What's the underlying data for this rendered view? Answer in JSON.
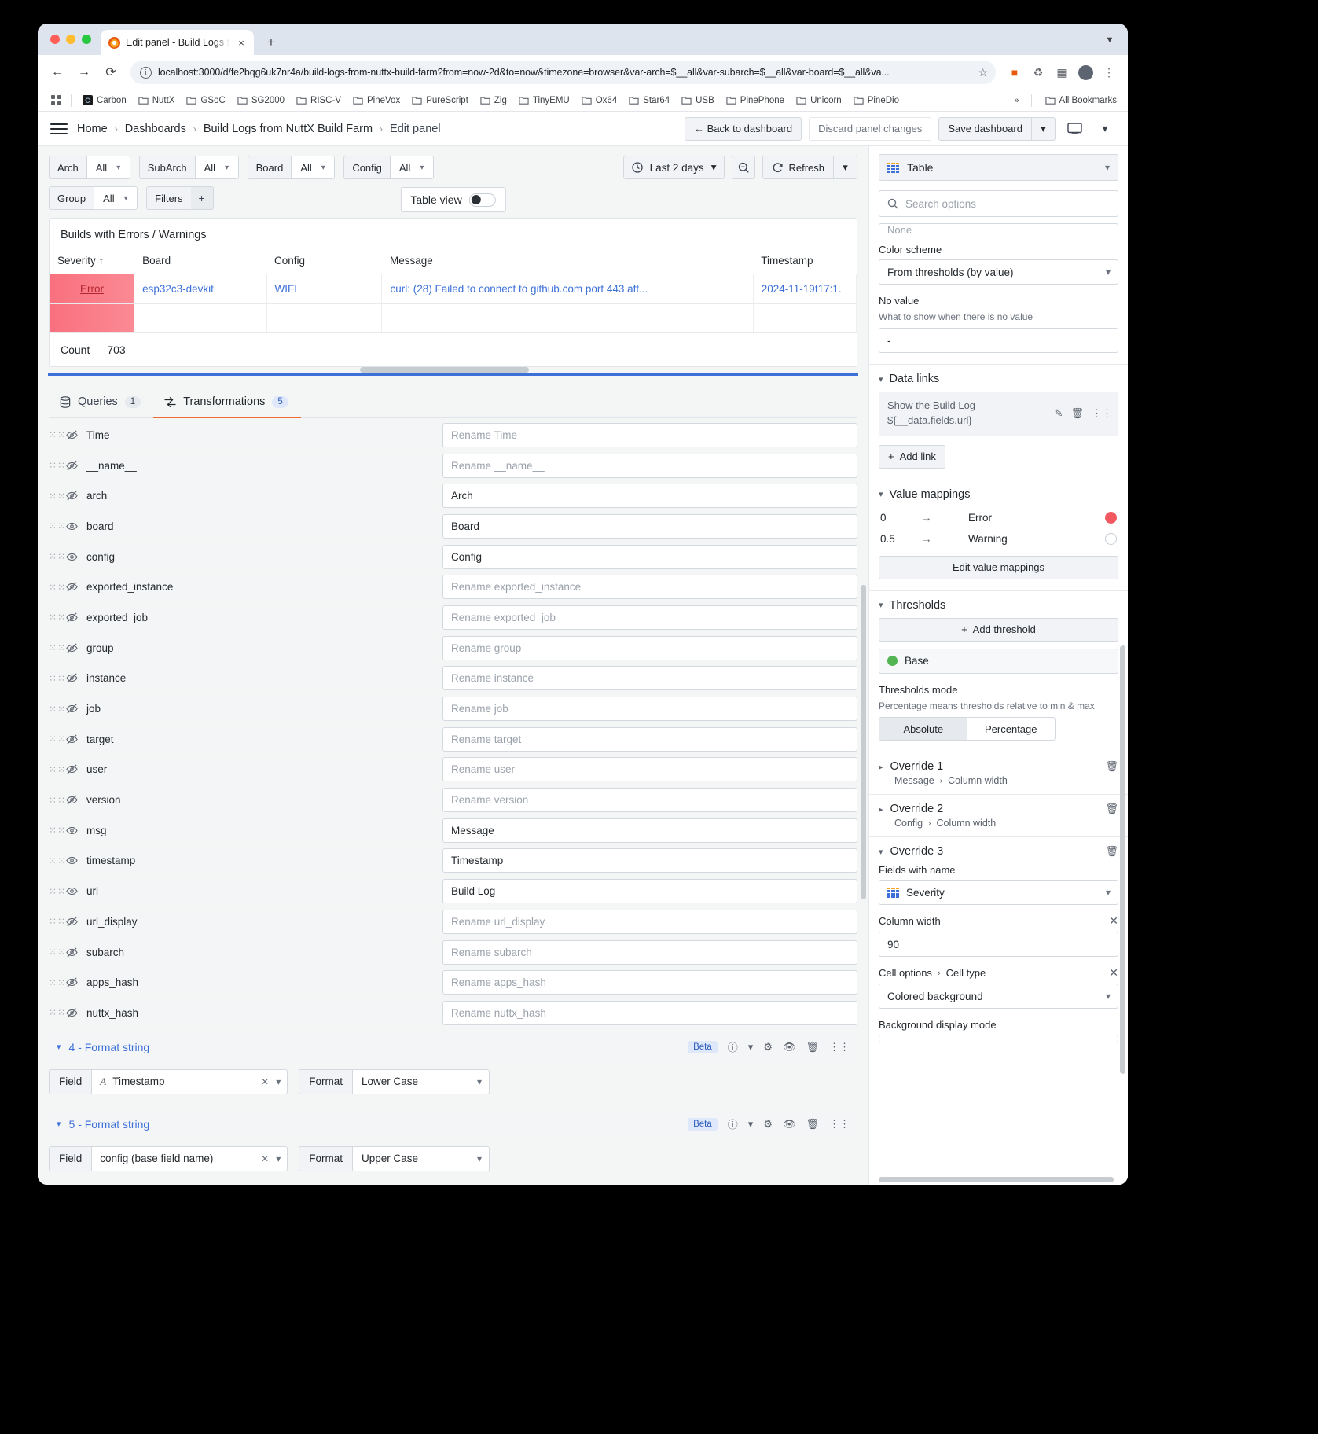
{
  "browser": {
    "tab_title": "Edit panel - Build Logs from N",
    "url": "localhost:3000/d/fe2bqg6uk7nr4a/build-logs-from-nuttx-build-farm?from=now-2d&to=now&timezone=browser&var-arch=$__all&var-subarch=$__all&var-board=$__all&va...",
    "new_tab_label": "+",
    "close_tab_label": "×",
    "bookmarks": [
      "Carbon",
      "NuttX",
      "GSoC",
      "SG2000",
      "RISC-V",
      "PineVox",
      "PureScript",
      "Zig",
      "TinyEMU",
      "Ox64",
      "Star64",
      "USB",
      "PinePhone",
      "Unicorn",
      "PineDio"
    ],
    "bookmarks_overflow": "»",
    "all_bookmarks": "All Bookmarks"
  },
  "nav": {
    "breadcrumbs": [
      "Home",
      "Dashboards",
      "Build Logs from NuttX Build Farm",
      "Edit panel"
    ],
    "back_to_dashboard": "←  Back to dashboard",
    "discard": "Discard panel changes",
    "save": "Save dashboard"
  },
  "variables": [
    {
      "label": "Arch",
      "value": "All"
    },
    {
      "label": "SubArch",
      "value": "All"
    },
    {
      "label": "Board",
      "value": "All"
    },
    {
      "label": "Config",
      "value": "All"
    },
    {
      "label": "Group",
      "value": "All"
    }
  ],
  "filters": {
    "label": "Filters",
    "add": "+"
  },
  "table_view": {
    "label": "Table view",
    "on": false
  },
  "time": {
    "range": "Last 2 days",
    "refresh": "Refresh"
  },
  "panel": {
    "title": "Builds with Errors / Warnings",
    "columns": [
      "Severity ↑",
      "Board",
      "Config",
      "Message",
      "Timestamp"
    ],
    "rows": [
      {
        "severity": "Error",
        "board": "esp32c3-devkit",
        "config": "WIFI",
        "message": "curl: (28) Failed to connect to github.com port 443 aft...",
        "timestamp": "2024-11-19t17:1."
      }
    ],
    "count_label": "Count",
    "count_value": "703"
  },
  "bottom_tabs": [
    {
      "label": "Queries",
      "count": "1",
      "active": false
    },
    {
      "label": "Transformations",
      "count": "5",
      "active": true
    }
  ],
  "organize_fields": [
    {
      "name": "Time",
      "visible": false,
      "rename": "Rename Time",
      "value": ""
    },
    {
      "name": "__name__",
      "visible": false,
      "rename": "Rename __name__",
      "value": ""
    },
    {
      "name": "arch",
      "visible": false,
      "rename": "",
      "value": "Arch"
    },
    {
      "name": "board",
      "visible": true,
      "rename": "",
      "value": "Board"
    },
    {
      "name": "config",
      "visible": true,
      "rename": "",
      "value": "Config"
    },
    {
      "name": "exported_instance",
      "visible": false,
      "rename": "Rename exported_instance",
      "value": ""
    },
    {
      "name": "exported_job",
      "visible": false,
      "rename": "Rename exported_job",
      "value": ""
    },
    {
      "name": "group",
      "visible": false,
      "rename": "Rename group",
      "value": ""
    },
    {
      "name": "instance",
      "visible": false,
      "rename": "Rename instance",
      "value": ""
    },
    {
      "name": "job",
      "visible": false,
      "rename": "Rename job",
      "value": ""
    },
    {
      "name": "target",
      "visible": false,
      "rename": "Rename target",
      "value": ""
    },
    {
      "name": "user",
      "visible": false,
      "rename": "Rename user",
      "value": ""
    },
    {
      "name": "version",
      "visible": false,
      "rename": "Rename version",
      "value": ""
    },
    {
      "name": "msg",
      "visible": true,
      "rename": "",
      "value": "Message"
    },
    {
      "name": "timestamp",
      "visible": true,
      "rename": "",
      "value": "Timestamp"
    },
    {
      "name": "url",
      "visible": true,
      "rename": "",
      "value": "Build Log"
    },
    {
      "name": "url_display",
      "visible": false,
      "rename": "Rename url_display",
      "value": ""
    },
    {
      "name": "subarch",
      "visible": false,
      "rename": "Rename subarch",
      "value": ""
    },
    {
      "name": "apps_hash",
      "visible": false,
      "rename": "Rename apps_hash",
      "value": ""
    },
    {
      "name": "nuttx_hash",
      "visible": false,
      "rename": "Rename nuttx_hash",
      "value": ""
    }
  ],
  "transform_sections": [
    {
      "title": "4 - Format string",
      "beta": "Beta",
      "field_label": "Field",
      "field_value": "Timestamp",
      "format_label": "Format",
      "format_value": "Lower Case"
    },
    {
      "title": "5 - Format string",
      "beta": "Beta",
      "field_label": "Field",
      "field_value": "config (base field name)",
      "format_label": "Format",
      "format_value": "Upper Case"
    }
  ],
  "options": {
    "viz_type": "Table",
    "search_placeholder": "Search options",
    "color_scheme": {
      "label": "Color scheme",
      "value": "From thresholds (by value)"
    },
    "no_value": {
      "label": "No value",
      "description": "What to show when there is no value",
      "value": "-"
    },
    "data_links": {
      "title": "Data links",
      "link_title": "Show the Build Log",
      "link_url": "${__data.fields.url}",
      "add_link": "Add link"
    },
    "value_mappings": {
      "title": "Value mappings",
      "rows": [
        {
          "key": "0",
          "arrow": "→",
          "value": "Error",
          "color": "#f2585f",
          "filled": true
        },
        {
          "key": "0.5",
          "arrow": "→",
          "value": "Warning",
          "color": "#ffffff",
          "filled": false
        }
      ],
      "edit_button": "Edit value mappings"
    },
    "thresholds": {
      "title": "Thresholds",
      "add_button": "Add threshold",
      "base_label": "Base",
      "base_color": "#52b552",
      "mode_label": "Thresholds mode",
      "mode_description": "Percentage means thresholds relative to min & max",
      "modes": [
        "Absolute",
        "Percentage"
      ],
      "mode_selected": "Absolute"
    },
    "overrides": [
      {
        "title": "Override 1",
        "field": "Message",
        "prop": "Column width",
        "expanded": false
      },
      {
        "title": "Override 2",
        "field": "Config",
        "prop": "Column width",
        "expanded": false
      },
      {
        "title": "Override 3",
        "expanded": true,
        "fields_with_name_label": "Fields with name",
        "fields_with_name_value": "Severity",
        "column_width_label": "Column width",
        "column_width_value": "90",
        "cell_options_label": "Cell options",
        "cell_type_label": "Cell type",
        "cell_type_value": "Colored background",
        "background_display_label": "Background display mode"
      }
    ]
  }
}
